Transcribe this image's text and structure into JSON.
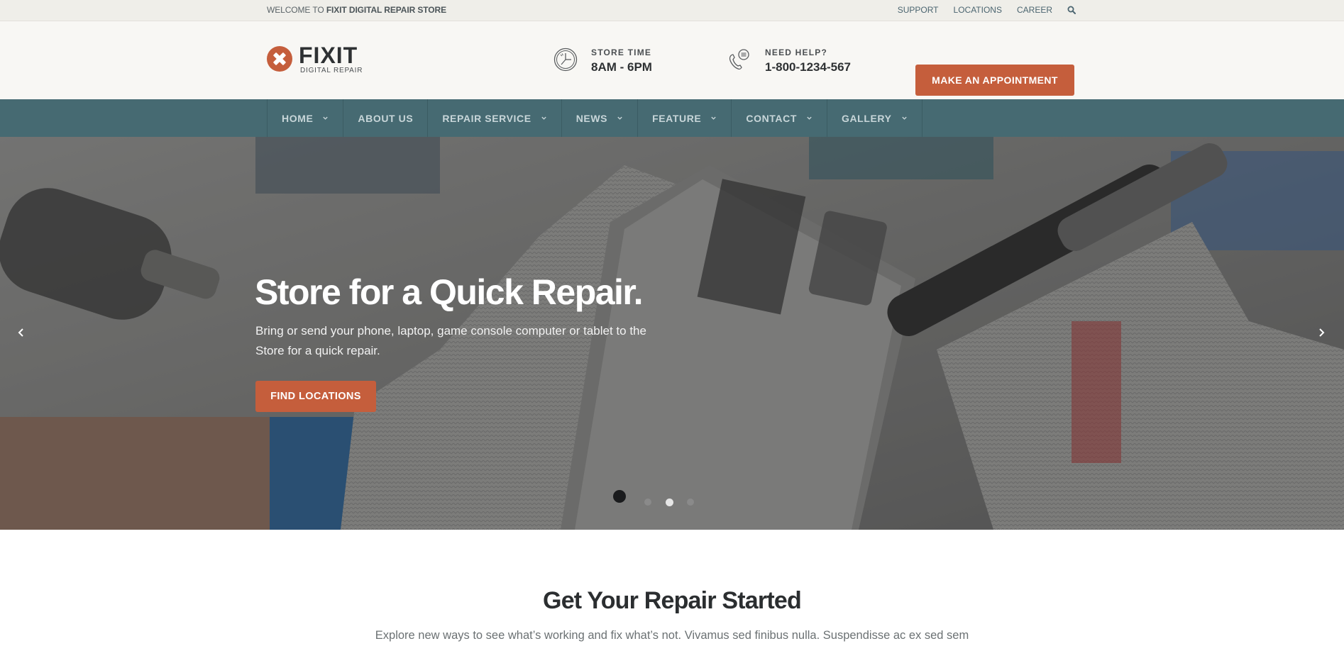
{
  "topbar": {
    "welcome_prefix": "WELCOME TO ",
    "welcome_store": "FIXIT DIGITAL REPAIR STORE",
    "links": [
      "SUPPORT",
      "LOCATIONS",
      "CAREER"
    ],
    "search_icon": "search-icon"
  },
  "header": {
    "logo_title": "FIXIT",
    "logo_subtitle": "DIGITAL REPAIR",
    "store_time_label": "STORE TIME",
    "store_time_value": "8AM - 6PM",
    "help_label": "NEED HELP?",
    "help_phone": "1-800-1234-567",
    "appointment_button": "MAKE AN APPOINTMENT"
  },
  "nav": {
    "items": [
      {
        "label": "HOME",
        "dropdown": true
      },
      {
        "label": "ABOUT US",
        "dropdown": false
      },
      {
        "label": "REPAIR SERVICE",
        "dropdown": true
      },
      {
        "label": "NEWS",
        "dropdown": true
      },
      {
        "label": "FEATURE",
        "dropdown": true
      },
      {
        "label": "CONTACT",
        "dropdown": true
      },
      {
        "label": "GALLERY",
        "dropdown": true
      }
    ]
  },
  "hero": {
    "title": "Store for a Quick Repair.",
    "description": "Bring or send your phone, laptop, game console computer or tablet to the Store for a quick repair.",
    "cta_button": "FIND LOCATIONS",
    "slides_count": 3,
    "active_slide": 2
  },
  "section": {
    "title": "Get Your Repair Started",
    "description": "Explore new ways to see what’s working and fix what’s not. Vivamus sed finibus nulla. Suspendisse ac ex sed sem"
  },
  "colors": {
    "accent": "#c55e3c",
    "nav_bg": "#466a72",
    "topbar_bg": "#efeee9",
    "header_bg": "#f8f7f4"
  }
}
